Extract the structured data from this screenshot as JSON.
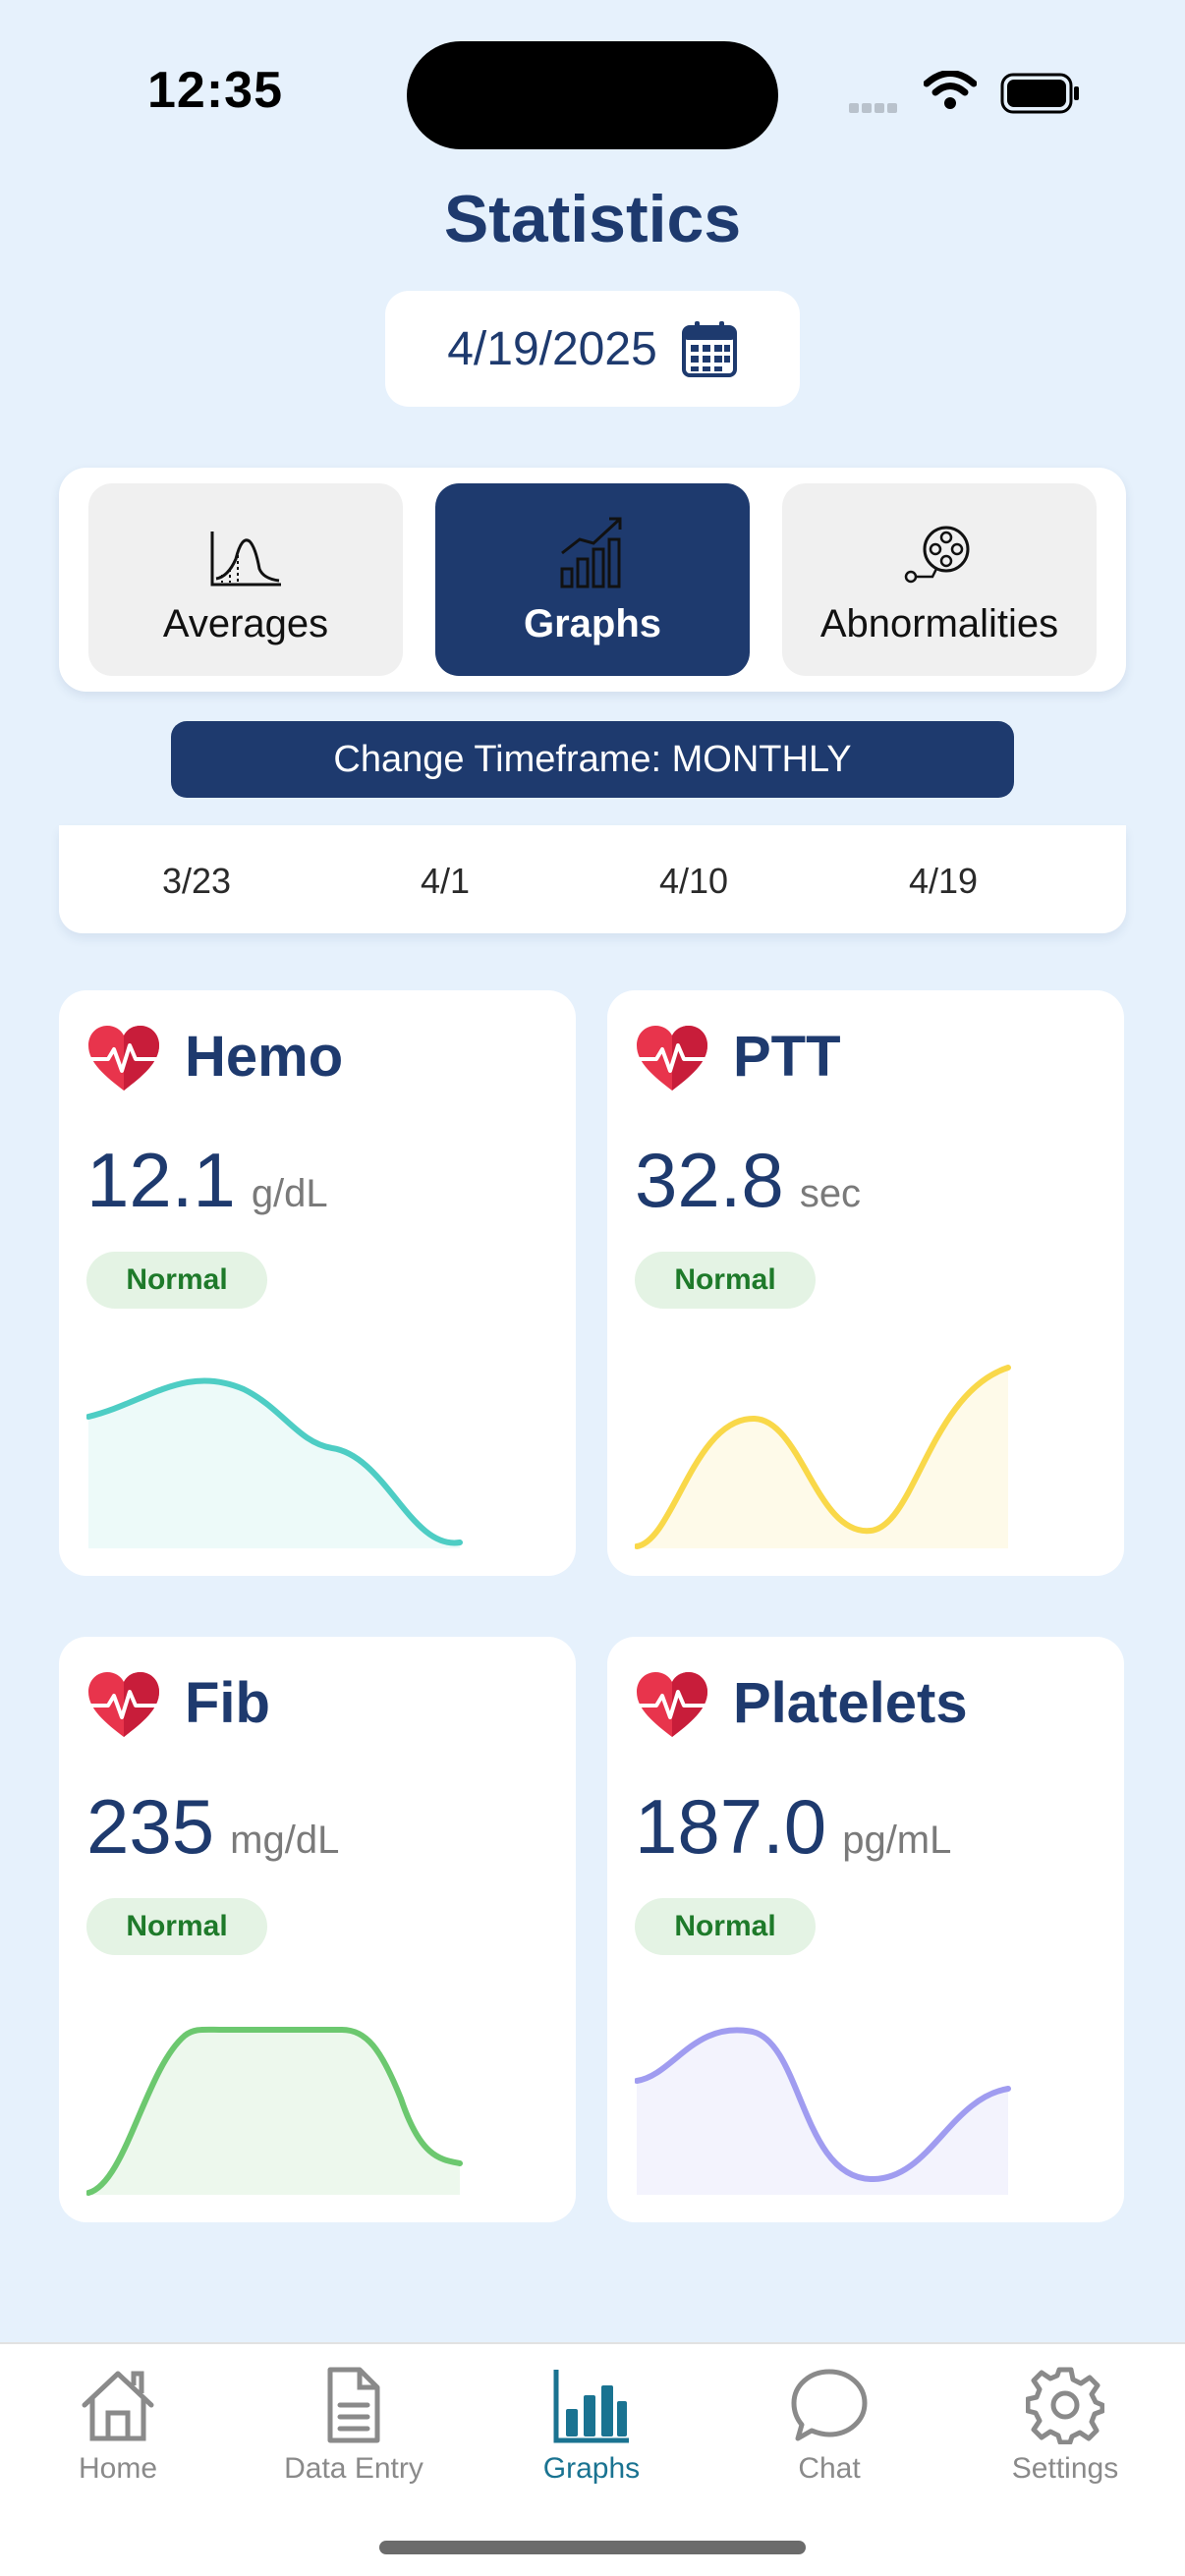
{
  "status_bar": {
    "time": "12:35"
  },
  "header": {
    "title": "Statistics",
    "date": "4/19/2025"
  },
  "segments": [
    {
      "label": "Averages",
      "active": false
    },
    {
      "label": "Graphs",
      "active": true
    },
    {
      "label": "Abnormalities",
      "active": false
    }
  ],
  "timeframe": {
    "button_label": "Change Timeframe: MONTHLY"
  },
  "timeline": {
    "ticks": [
      "3/23",
      "4/1",
      "4/10",
      "4/19"
    ]
  },
  "cards": [
    {
      "name": "Hemo",
      "value": "12.1",
      "unit": "g/dL",
      "status": "Normal",
      "color": "#4ecdc4"
    },
    {
      "name": "PTT",
      "value": "32.8",
      "unit": "sec",
      "status": "Normal",
      "color": "#f9d849"
    },
    {
      "name": "Fib",
      "value": "235",
      "unit": "mg/dL",
      "status": "Normal",
      "color": "#6cc86f"
    },
    {
      "name": "Platelets",
      "value": "187.0",
      "unit": "pg/mL",
      "status": "Normal",
      "color": "#a09cf0"
    }
  ],
  "tab_bar": {
    "items": [
      {
        "label": "Home",
        "icon": "home-icon"
      },
      {
        "label": "Data Entry",
        "icon": "document-icon"
      },
      {
        "label": "Graphs",
        "icon": "bar-chart-icon",
        "active": true
      },
      {
        "label": "Chat",
        "icon": "chat-bubble-icon"
      },
      {
        "label": "Settings",
        "icon": "gear-icon"
      }
    ]
  },
  "colors": {
    "navy": "#1e3a6e",
    "background": "#e6f1fc",
    "tab_active": "#1a7391",
    "normal_badge": "#e4f3e4"
  }
}
